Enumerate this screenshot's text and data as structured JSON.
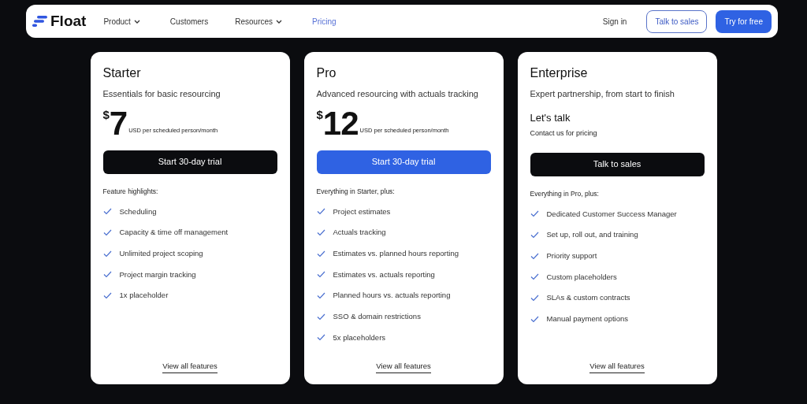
{
  "navbar": {
    "logo": "Float",
    "links": [
      {
        "label": "Product",
        "dropdown": true,
        "selected": false
      },
      {
        "label": "Customers",
        "dropdown": false,
        "selected": false
      },
      {
        "label": "Resources",
        "dropdown": true,
        "selected": false
      },
      {
        "label": "Pricing",
        "dropdown": false,
        "selected": true
      }
    ],
    "sign_in": "Sign in",
    "talk_to_sales": "Talk to sales",
    "try_free": "Try for free"
  },
  "plans": [
    {
      "name": "Starter",
      "tagline": "Essentials for basic resourcing",
      "price": {
        "kind": "amount",
        "currency": "$",
        "amount": "7",
        "unit": "USD per scheduled person/month"
      },
      "cta": {
        "label": "Start 30-day trial",
        "highlighted": false
      },
      "features_heading": "Feature highlights:",
      "features": [
        "Scheduling",
        "Capacity & time off management",
        "Unlimited project scoping",
        "Project margin tracking",
        "1x placeholder"
      ],
      "link": "View all features"
    },
    {
      "name": "Pro",
      "tagline": "Advanced resourcing with actuals tracking",
      "price": {
        "kind": "amount",
        "currency": "$",
        "amount": "12",
        "unit": "USD per scheduled person/month"
      },
      "cta": {
        "label": "Start 30-day trial",
        "highlighted": true
      },
      "features_heading": "Everything in Starter, plus:",
      "features": [
        "Project estimates",
        "Actuals tracking",
        "Estimates vs. planned hours reporting",
        "Estimates vs. actuals reporting",
        "Planned hours vs. actuals reporting",
        "SSO & domain restrictions",
        "5x placeholders"
      ],
      "link": "View all features"
    },
    {
      "name": "Enterprise",
      "tagline": "Expert partnership, from start to finish",
      "price": {
        "kind": "contact",
        "title": "Let's talk",
        "note": "Contact us for pricing"
      },
      "cta": {
        "label": "Talk to sales",
        "highlighted": false
      },
      "features_heading": "Everything in Pro, plus:",
      "features": [
        "Dedicated Customer Success Manager",
        "Set up, roll out, and training",
        "Priority support",
        "Custom placeholders",
        "SLAs & custom contracts",
        "Manual payment options"
      ],
      "link": "View all features"
    }
  ]
}
